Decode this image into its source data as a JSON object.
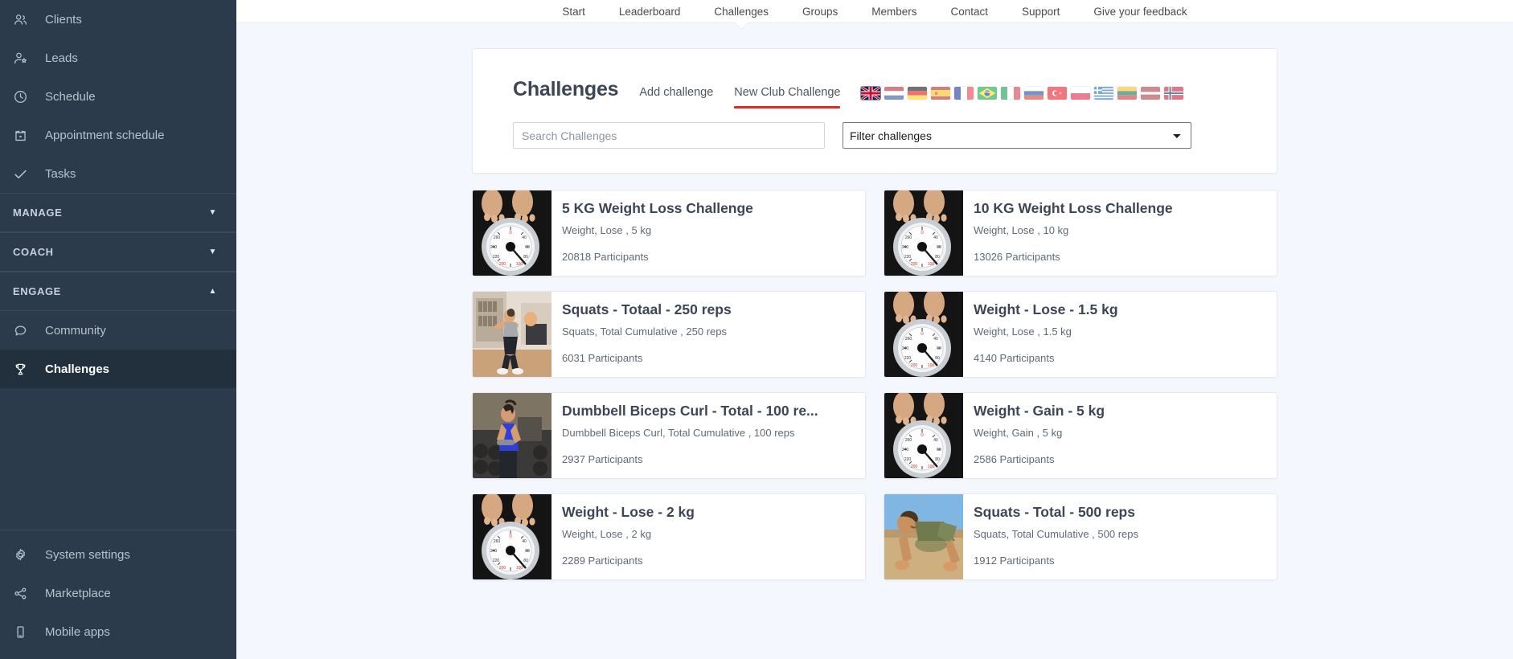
{
  "sidebar": {
    "top_items": [
      {
        "label": "Clients",
        "icon": "users-icon"
      },
      {
        "label": "Leads",
        "icon": "user-star-icon"
      },
      {
        "label": "Schedule",
        "icon": "clock-icon"
      },
      {
        "label": "Appointment schedule",
        "icon": "calendar-icon"
      },
      {
        "label": "Tasks",
        "icon": "check-icon"
      }
    ],
    "groups": [
      {
        "label": "MANAGE",
        "expanded": false,
        "caret": "▼"
      },
      {
        "label": "COACH",
        "expanded": false,
        "caret": "▼"
      },
      {
        "label": "ENGAGE",
        "expanded": true,
        "caret": "▲"
      }
    ],
    "engage_items": [
      {
        "label": "Community",
        "icon": "chat-bubble-icon",
        "active": false
      },
      {
        "label": "Challenges",
        "icon": "trophy-icon",
        "active": true
      }
    ],
    "bottom_items": [
      {
        "label": "System settings",
        "icon": "gear-icon"
      },
      {
        "label": "Marketplace",
        "icon": "share-icon"
      },
      {
        "label": "Mobile apps",
        "icon": "mobile-icon"
      }
    ]
  },
  "topnav": {
    "items": [
      {
        "label": "Start",
        "selected": false
      },
      {
        "label": "Leaderboard",
        "selected": false
      },
      {
        "label": "Challenges",
        "selected": true
      },
      {
        "label": "Groups",
        "selected": false
      },
      {
        "label": "Members",
        "selected": false
      },
      {
        "label": "Contact",
        "selected": false
      },
      {
        "label": "Support",
        "selected": false
      },
      {
        "label": "Give your feedback",
        "selected": false
      }
    ]
  },
  "header": {
    "title": "Challenges",
    "add_challenge_label": "Add challenge",
    "new_club_challenge_label": "New Club Challenge",
    "accent_underline_color": "#e02a2a",
    "flags": [
      {
        "name": "flag-uk",
        "selected": true
      },
      {
        "name": "flag-netherlands",
        "selected": false
      },
      {
        "name": "flag-germany",
        "selected": false
      },
      {
        "name": "flag-spain",
        "selected": false
      },
      {
        "name": "flag-france",
        "selected": false
      },
      {
        "name": "flag-brazil",
        "selected": false
      },
      {
        "name": "flag-italy",
        "selected": false
      },
      {
        "name": "flag-russia",
        "selected": false
      },
      {
        "name": "flag-turkey",
        "selected": false
      },
      {
        "name": "flag-poland",
        "selected": false
      },
      {
        "name": "flag-greece",
        "selected": false
      },
      {
        "name": "flag-lithuania",
        "selected": false
      },
      {
        "name": "flag-latvia",
        "selected": false
      },
      {
        "name": "flag-norway",
        "selected": false
      }
    ]
  },
  "search": {
    "placeholder": "Search Challenges",
    "value": ""
  },
  "filter": {
    "selected": "Filter challenges"
  },
  "challenges": [
    {
      "title": "5 KG Weight Loss Challenge",
      "subtitle": "Weight, Lose , 5 kg",
      "participants": "20818 Participants",
      "thumb": "scale"
    },
    {
      "title": "10 KG Weight Loss Challenge",
      "subtitle": "Weight, Lose , 10 kg",
      "participants": "13026 Participants",
      "thumb": "scale"
    },
    {
      "title": "Squats - Totaal - 250 reps",
      "subtitle": "Squats, Total Cumulative , 250 reps",
      "participants": "6031 Participants",
      "thumb": "squat"
    },
    {
      "title": "Weight - Lose - 1.5 kg",
      "subtitle": "Weight, Lose , 1.5 kg",
      "participants": "4140 Participants",
      "thumb": "scale"
    },
    {
      "title": "Dumbbell Biceps Curl - Total - 100 re...",
      "subtitle": "Dumbbell Biceps Curl, Total Cumulative , 100 reps",
      "participants": "2937 Participants",
      "thumb": "dumbbell"
    },
    {
      "title": "Weight - Gain - 5 kg",
      "subtitle": "Weight, Gain , 5 kg",
      "participants": "2586 Participants",
      "thumb": "scale"
    },
    {
      "title": "Weight - Lose - 2 kg",
      "subtitle": "Weight, Lose , 2 kg",
      "participants": "2289 Participants",
      "thumb": "scale"
    },
    {
      "title": "Squats - Total - 500 reps",
      "subtitle": "Squats, Total Cumulative , 500 reps",
      "participants": "1912 Participants",
      "thumb": "pushup"
    }
  ]
}
